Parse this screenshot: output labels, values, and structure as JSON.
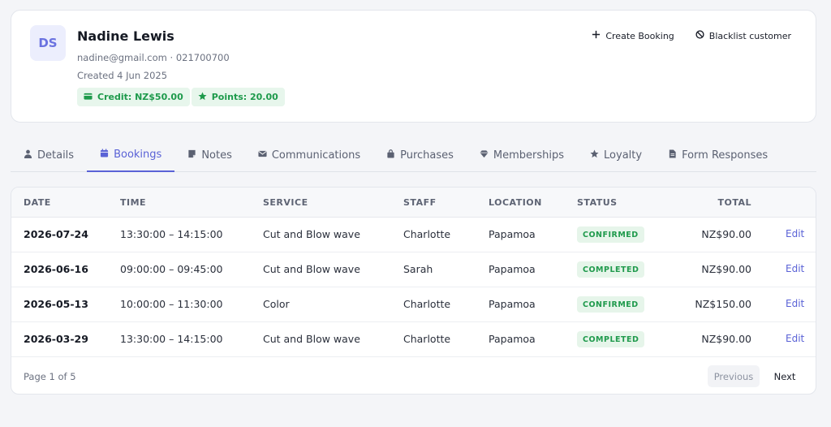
{
  "customer": {
    "initials": "DS",
    "name": "Nadine Lewis",
    "contact": "nadine@gmail.com · 021700700",
    "created": "Created 4 Jun 2025",
    "credit": "Credit: NZ$50.00",
    "points": "Points: 20.00"
  },
  "actions": {
    "create_booking": "Create Booking",
    "blacklist": "Blacklist customer"
  },
  "tabs": [
    {
      "label": "Details",
      "icon": "user-icon"
    },
    {
      "label": "Bookings",
      "icon": "calendar-icon"
    },
    {
      "label": "Notes",
      "icon": "note-icon"
    },
    {
      "label": "Communications",
      "icon": "envelope-icon"
    },
    {
      "label": "Purchases",
      "icon": "bag-icon"
    },
    {
      "label": "Memberships",
      "icon": "gem-icon"
    },
    {
      "label": "Loyalty",
      "icon": "star-icon"
    },
    {
      "label": "Form Responses",
      "icon": "document-icon"
    }
  ],
  "active_tab": "Bookings",
  "table": {
    "headers": [
      "DATE",
      "TIME",
      "SERVICE",
      "STAFF",
      "LOCATION",
      "STATUS",
      "TOTAL"
    ],
    "rows": [
      {
        "date": "2026-07-24",
        "time": "13:30:00 – 14:15:00",
        "service": "Cut and Blow wave",
        "staff": "Charlotte",
        "location": "Papamoa",
        "status": "CONFIRMED",
        "total": "NZ$90.00",
        "action": "Edit"
      },
      {
        "date": "2026-06-16",
        "time": "09:00:00 – 09:45:00",
        "service": "Cut and Blow wave",
        "staff": "Sarah",
        "location": "Papamoa",
        "status": "COMPLETED",
        "total": "NZ$90.00",
        "action": "Edit"
      },
      {
        "date": "2026-05-13",
        "time": "10:00:00 – 11:30:00",
        "service": "Color",
        "staff": "Charlotte",
        "location": "Papamoa",
        "status": "CONFIRMED",
        "total": "NZ$150.00",
        "action": "Edit"
      },
      {
        "date": "2026-03-29",
        "time": "13:30:00 – 14:15:00",
        "service": "Cut and Blow wave",
        "staff": "Charlotte",
        "location": "Papamoa",
        "status": "COMPLETED",
        "total": "NZ$90.00",
        "action": "Edit"
      }
    ]
  },
  "pagination": {
    "info": "Page 1 of 5",
    "previous": "Previous",
    "next": "Next"
  },
  "colors": {
    "accent": "#5a62d6",
    "success": "#1f9a4c",
    "success_bg": "#e6f5ea"
  }
}
